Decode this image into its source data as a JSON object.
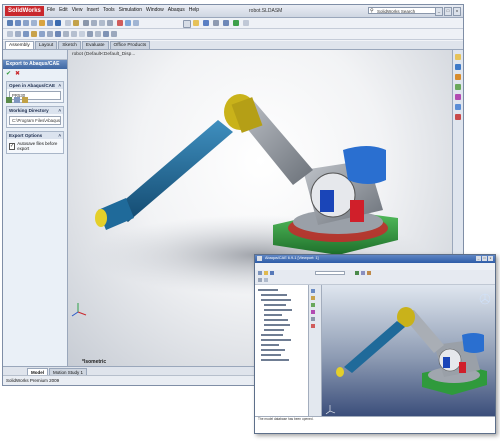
{
  "solidworks": {
    "logo": "SolidWorks",
    "menu": [
      "File",
      "Edit",
      "View",
      "Insert",
      "Tools",
      "Simulation",
      "Window",
      "Abaqus",
      "Help"
    ],
    "title": "robot.SLDASM",
    "search_placeholder": "SolidWorks Search",
    "command_tabs": [
      "Assembly",
      "Layout",
      "Sketch",
      "Evaluate",
      "Office Products"
    ],
    "active_tab": "Assembly",
    "property_manager": {
      "title": "Export to Abaqus/CAE",
      "ok": "✔",
      "cancel": "✖",
      "groups": {
        "open_in": {
          "label": "Open in Abaqus/CAE",
          "value": "PR530"
        },
        "working_dir": {
          "label": "Working Directory",
          "value": "C:\\Program Files\\Abaqus\\SolidW"
        },
        "export_options": {
          "label": "Export Options",
          "checkbox": "Autosave files before export",
          "checked": true
        }
      }
    },
    "viewport": {
      "tree_label": "robot (Default<Default_Disp...",
      "view_label": "*Isometric"
    },
    "bottom_tabs": [
      "Model",
      "Motion Study 1"
    ],
    "active_bottom_tab": "Model",
    "status": "SolidWorks Premium 2009"
  },
  "abaqus": {
    "title": "Abaqus/CAE 6.9-1 [Viewport: 1]",
    "message": "The model database has been opened."
  },
  "colors": {
    "arm_blue": "#1f6a9a",
    "joint_yellow": "#c9b21a",
    "link_gray": "#8c929a",
    "motor_blue": "#2a6fd0",
    "base_green": "#2f9a3c",
    "accent_red": "#d01f2a",
    "sw_red": "#c9282d"
  }
}
